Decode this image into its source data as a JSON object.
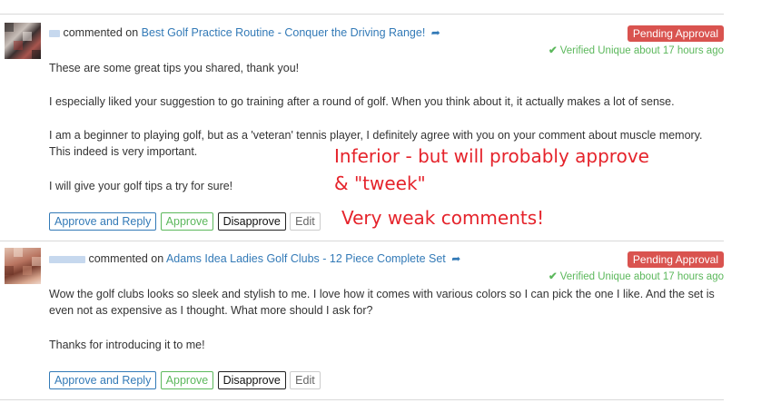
{
  "comments": [
    {
      "verb": "commented on",
      "post_title": "Best Golf Practice Routine - Conquer the Driving Range!",
      "status": "Pending Approval",
      "verified": "Verified Unique about 17 hours ago",
      "paragraphs": [
        "These are some great tips you shared, thank you!",
        "I especially liked your suggestion to go training after a round of golf. When you think about it, it actually makes a lot of sense.",
        "I am a beginner to playing golf, but as a 'veteran' tennis player, I definitely agree with you on your comment about muscle memory. This indeed is very important.",
        "I will give your golf tips a try for sure!"
      ],
      "actions": {
        "approve_reply": "Approve and Reply",
        "approve": "Approve",
        "disapprove": "Disapprove",
        "edit": "Edit"
      }
    },
    {
      "verb": "commented on",
      "post_title": "Adams Idea Ladies Golf Clubs - 12 Piece Complete Set",
      "status": "Pending Approval",
      "verified": "Verified Unique about 17 hours ago",
      "paragraphs": [
        "Wow the golf clubs looks so sleek and stylish to me. I love how it comes with various colors so I can pick the one I like. And the set is even not as expensive as I thought. What more should I ask for?",
        "Thanks for introducing it to me!"
      ],
      "actions": {
        "approve_reply": "Approve and Reply",
        "approve": "Approve",
        "disapprove": "Disapprove",
        "edit": "Edit"
      }
    }
  ],
  "annotations": {
    "line1": "Inferior - but will probably approve",
    "line2": "& \"tweek\"",
    "line3": "Very weak comments!"
  },
  "colors": {
    "link": "#337ab7",
    "badge": "#d9534f",
    "verified": "#5cb85c",
    "annotation": "#e5232b"
  },
  "icons": {
    "link_arrow": "share-arrow-icon",
    "verified": "check-icon"
  }
}
